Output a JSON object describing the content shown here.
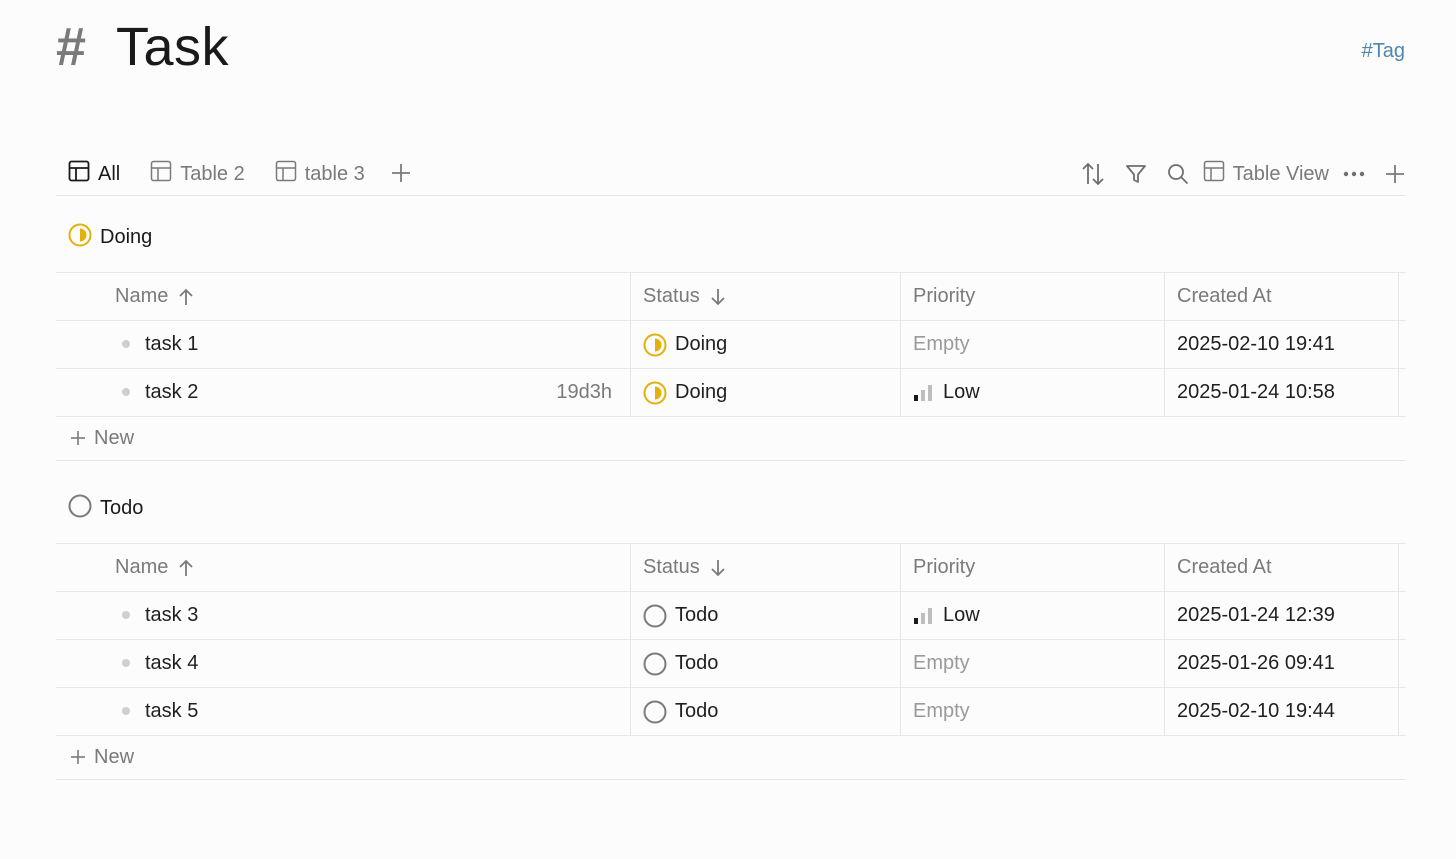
{
  "header": {
    "title": "Task",
    "tag": "#Tag"
  },
  "tabs": [
    {
      "label": "All",
      "active": true
    },
    {
      "label": "Table 2",
      "active": false
    },
    {
      "label": "table 3",
      "active": false
    }
  ],
  "toolbar": {
    "view_label": "Table View"
  },
  "columns": {
    "name": "Name",
    "status": "Status",
    "priority": "Priority",
    "created": "Created At"
  },
  "groups": [
    {
      "label": "Doing",
      "rows": [
        {
          "name": "task 1",
          "duration": "",
          "status": "Doing",
          "priority": "Empty",
          "created": "2025-02-10 19:41"
        },
        {
          "name": "task 2",
          "duration": "19d3h",
          "status": "Doing",
          "priority": "Low",
          "created": "2025-01-24 10:58"
        }
      ],
      "new_label": "New"
    },
    {
      "label": "Todo",
      "rows": [
        {
          "name": "task 3",
          "duration": "",
          "status": "Todo",
          "priority": "Low",
          "created": "2025-01-24 12:39"
        },
        {
          "name": "task 4",
          "duration": "",
          "status": "Todo",
          "priority": "Empty",
          "created": "2025-01-26 09:41"
        },
        {
          "name": "task 5",
          "duration": "",
          "status": "Todo",
          "priority": "Empty",
          "created": "2025-02-10 19:44"
        }
      ],
      "new_label": "New"
    }
  ],
  "colors": {
    "doing": "#e2b20c",
    "todo": "#7a7a7a",
    "tag": "#4f86ad"
  }
}
